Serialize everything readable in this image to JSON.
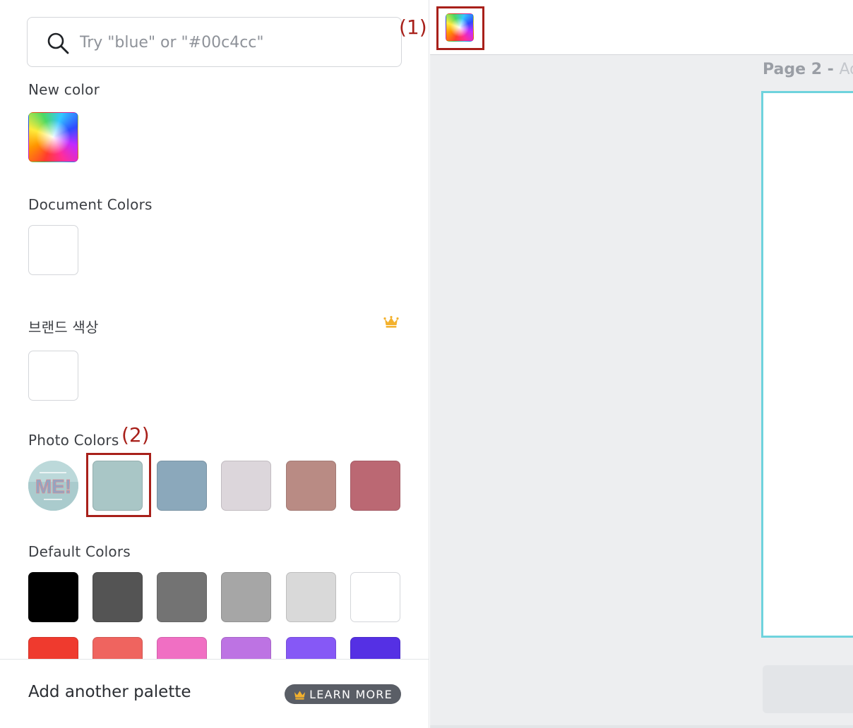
{
  "search": {
    "placeholder": "Try \"blue\" or \"#00c4cc\""
  },
  "sections": {
    "new_color": "New color",
    "document_colors": "Document Colors",
    "brand_colors": "브랜드 색상",
    "photo_colors": "Photo Colors",
    "default_colors": "Default Colors"
  },
  "photo": {
    "thumb_text": "ME!"
  },
  "photo_colors": [
    "#a9c6c6",
    "#8ba8bb",
    "#dcd6db",
    "#b98b84",
    "#bb6873"
  ],
  "default_colors": [
    "#000000",
    "#545454",
    "#737373",
    "#a6a6a6",
    "#d9d9d9",
    "#ffffff",
    "#ef3a2e",
    "#ef645f",
    "#f06fc3",
    "#bd73e3",
    "#8658f6",
    "#5530e4"
  ],
  "footer": {
    "add_palette": "Add another palette",
    "learn_more": "LEARN MORE"
  },
  "annotations": {
    "label_1": "(1)",
    "label_2": "(2)"
  },
  "canvas": {
    "page_number": "Page 2 -",
    "page_title_hint": "Add"
  },
  "icons": {
    "search": "search-icon",
    "crown": "crown-icon",
    "rainbow": "rainbow-picker-icon"
  },
  "colors": {
    "accent_annotation": "#a8201a",
    "page_border": "#6fd3dd",
    "premium_crown": "#f3b12d"
  }
}
